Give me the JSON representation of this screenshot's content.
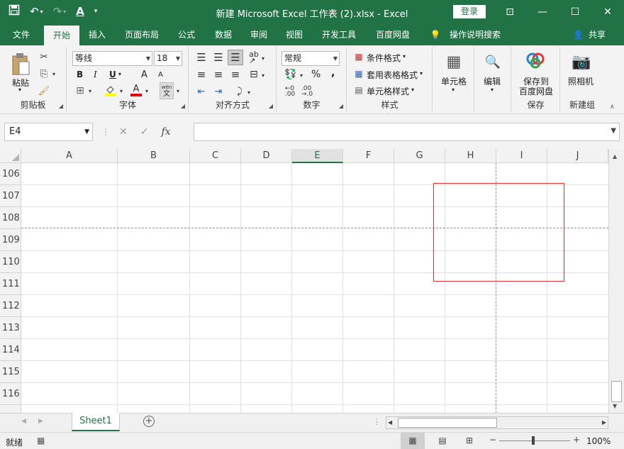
{
  "title_bar": {
    "title": "新建 Microsoft Excel 工作表 (2).xlsx  -  Excel",
    "login": "登录"
  },
  "tabs": [
    "文件",
    "开始",
    "插入",
    "页面布局",
    "公式",
    "数据",
    "审阅",
    "视图",
    "开发工具",
    "百度网盘",
    "操作说明搜索",
    "共享"
  ],
  "ribbon": {
    "paste": "粘贴",
    "clipboard": "剪贴板",
    "font_name": "等线",
    "font_size": "18",
    "bold": "B",
    "italic": "I",
    "underline": "U",
    "font_color_a": "A",
    "grow_font": "A",
    "shrink_font": "A",
    "wen": "wén",
    "wen_char": "文",
    "font_group": "字体",
    "align_group": "对齐方式",
    "number_format": "常规",
    "percent": "%",
    "comma": ",",
    "number_group": "数字",
    "conditional": "条件格式",
    "table_format": "套用表格格式",
    "cell_style": "单元格样式",
    "style_group": "样式",
    "cells": "单元格",
    "edit": "编辑",
    "save_to": "保存到",
    "baidu_disk": "百度网盘",
    "save_group": "保存",
    "camera": "照相机",
    "new_group": "新建组"
  },
  "formula_bar": {
    "name_box": "E4",
    "fx": "fx",
    "value": ""
  },
  "columns": [
    "A",
    "B",
    "C",
    "D",
    "E",
    "F",
    "G",
    "H",
    "I",
    "J"
  ],
  "rows": [
    "106",
    "107",
    "108",
    "109",
    "110",
    "111",
    "112",
    "113",
    "114",
    "115",
    "116"
  ],
  "selected_column": "E",
  "sheet_tab": "Sheet1",
  "status": {
    "ready": "就绪",
    "zoom": "100%"
  },
  "colors": {
    "excel_green": "#217346",
    "red_box": "#e0303a"
  }
}
